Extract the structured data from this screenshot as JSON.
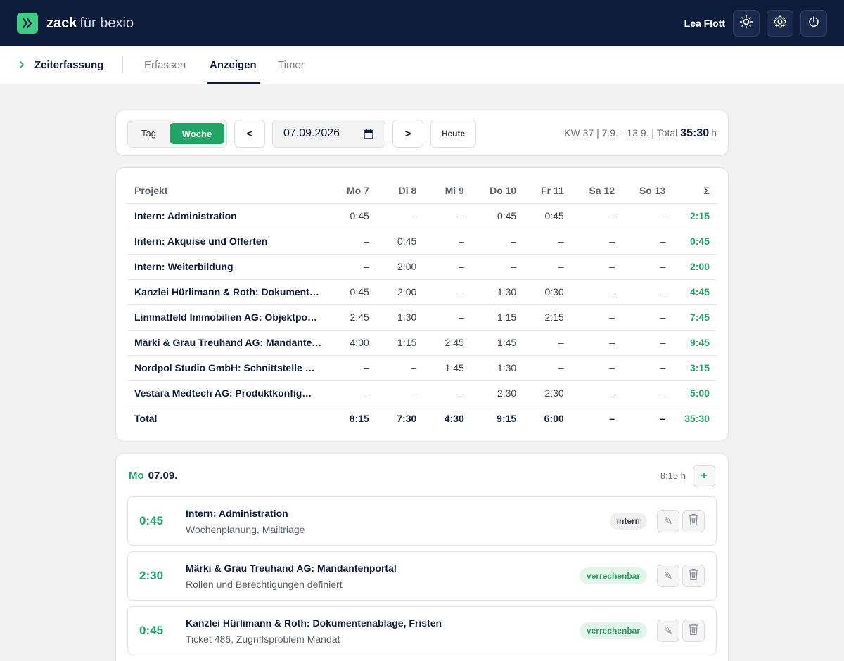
{
  "header": {
    "brand_bold": "zack",
    "brand_rest": "für bexio",
    "user_name": "Lea Flott",
    "icons": [
      "theme-sun-icon",
      "gear-icon",
      "power-icon"
    ]
  },
  "subnav": {
    "section": "Zeiterfassung",
    "tabs": [
      {
        "label": "Erfassen",
        "active": false
      },
      {
        "label": "Anzeigen",
        "active": true
      },
      {
        "label": "Timer",
        "active": false
      }
    ]
  },
  "controls": {
    "view_day": "Tag",
    "view_week": "Woche",
    "prev": "<",
    "next": ">",
    "date_value": "07.09.2026",
    "today": "Heute",
    "week_info": "KW 37 | 7.9. - 13.9. | Total",
    "week_total": "35:30",
    "week_unit": "h"
  },
  "week_table": {
    "headers": [
      "Projekt",
      "Mo 7",
      "Di 8",
      "Mi 9",
      "Do 10",
      "Fr 11",
      "Sa 12",
      "So 13",
      "Σ"
    ],
    "rows": [
      {
        "project": "Intern: Administration",
        "cells": [
          "0:45",
          "–",
          "–",
          "0:45",
          "0:45",
          "–",
          "–"
        ],
        "sum": "2:15"
      },
      {
        "project": "Intern: Akquise und Offerten",
        "cells": [
          "–",
          "0:45",
          "–",
          "–",
          "–",
          "–",
          "–"
        ],
        "sum": "0:45"
      },
      {
        "project": "Intern: Weiterbildung",
        "cells": [
          "–",
          "2:00",
          "–",
          "–",
          "–",
          "–",
          "–"
        ],
        "sum": "2:00"
      },
      {
        "project": "Kanzlei Hürlimann & Roth: Dokument…",
        "cells": [
          "0:45",
          "2:00",
          "–",
          "1:30",
          "0:30",
          "–",
          "–"
        ],
        "sum": "4:45"
      },
      {
        "project": "Limmatfeld Immobilien AG: Objektpo…",
        "cells": [
          "2:45",
          "1:30",
          "–",
          "1:15",
          "2:15",
          "–",
          "–"
        ],
        "sum": "7:45"
      },
      {
        "project": "Märki & Grau Treuhand AG: Mandante…",
        "cells": [
          "4:00",
          "1:15",
          "2:45",
          "1:45",
          "–",
          "–",
          "–"
        ],
        "sum": "9:45"
      },
      {
        "project": "Nordpol Studio GmbH: Schnittstelle …",
        "cells": [
          "–",
          "–",
          "1:45",
          "1:30",
          "–",
          "–",
          "–"
        ],
        "sum": "3:15"
      },
      {
        "project": "Vestara Medtech AG: Produktkonfig…",
        "cells": [
          "–",
          "–",
          "–",
          "2:30",
          "2:30",
          "–",
          "–"
        ],
        "sum": "5:00"
      }
    ],
    "total": {
      "label": "Total",
      "cells": [
        "8:15",
        "7:30",
        "4:30",
        "9:15",
        "6:00",
        "–",
        "–"
      ],
      "sum": "35:30"
    }
  },
  "day": {
    "day_name": "Mo",
    "date": "07.09.",
    "hours": "8:15 h",
    "add": "+",
    "entries": [
      {
        "duration": "0:45",
        "title": "Intern: Administration",
        "desc": "Wochenplanung, Mailtriage",
        "badge": "intern",
        "badge_type": "intern"
      },
      {
        "duration": "2:30",
        "title": "Märki & Grau Treuhand AG: Mandantenportal",
        "desc": "Rollen und Berechtigungen definiert",
        "badge": "verrechenbar",
        "badge_type": "bill"
      },
      {
        "duration": "0:45",
        "title": "Kanzlei Hürlimann & Roth: Dokumentenablage, Fristen",
        "desc": "Ticket 486, Zugriffsproblem Mandat",
        "badge": "verrechenbar",
        "badge_type": "bill"
      }
    ]
  },
  "colors": {
    "header_bg": "#0e1c3b",
    "accent_green": "#22a466",
    "logo_green": "#3ecb84"
  }
}
